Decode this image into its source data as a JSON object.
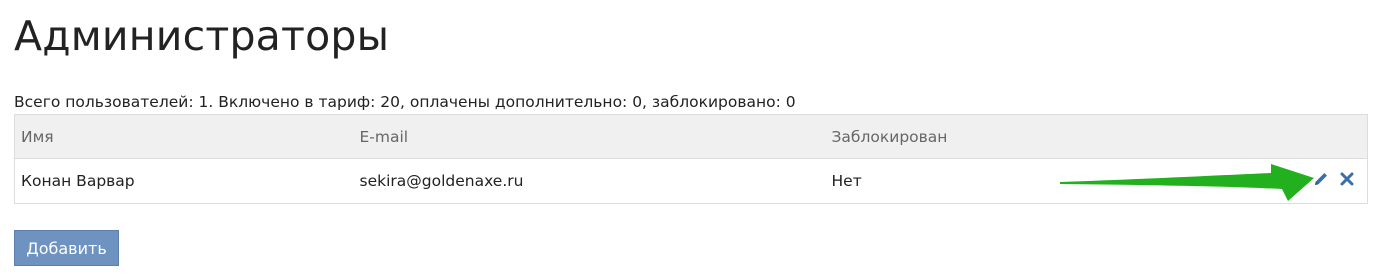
{
  "header": {
    "title": "Администраторы"
  },
  "summary": {
    "text": "Всего пользователей: 1. Включено в тариф: 20, оплачены дополнительно: 0, заблокировано: 0"
  },
  "table": {
    "columns": [
      "Имя",
      "E-mail",
      "Заблокирован"
    ],
    "rows": [
      {
        "name": "Конан Варвар",
        "email": "sekira@goldenaxe.ru",
        "blocked": "Нет",
        "actions": [
          "pencil-icon",
          "close-icon"
        ]
      }
    ]
  },
  "annotation": {
    "arrow_color": "#22b01e",
    "points_to": "pencil-icon"
  },
  "colors": {
    "icon": "#3a6fa8",
    "button_bg": "#6f93c1",
    "header_bg": "#f0f0f0"
  },
  "actions": {
    "add_label": "Добавить"
  }
}
